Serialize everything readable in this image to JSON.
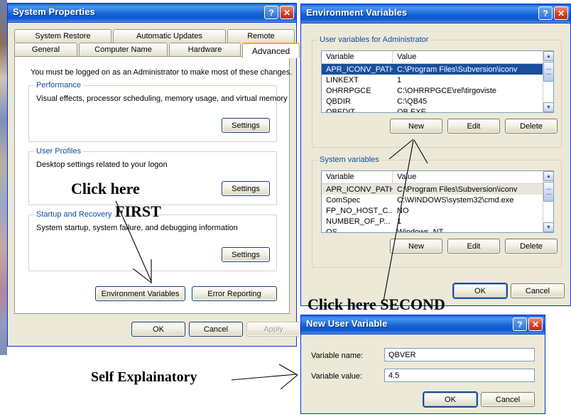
{
  "system_properties": {
    "title": "System Properties",
    "titlebar_buttons": [
      {
        "name": "help-button",
        "glyph": "?"
      },
      {
        "name": "close-button",
        "glyph": "✕"
      }
    ],
    "tabs_row1": [
      {
        "label": "System Restore",
        "active": false
      },
      {
        "label": "Automatic Updates",
        "active": false
      },
      {
        "label": "Remote",
        "active": false
      }
    ],
    "tabs_row2": [
      {
        "label": "General",
        "active": false
      },
      {
        "label": "Computer Name",
        "active": false
      },
      {
        "label": "Hardware",
        "active": false
      },
      {
        "label": "Advanced",
        "active": true
      }
    ],
    "intro_text": "You must be logged on as an Administrator to make most of these changes.",
    "groups": [
      {
        "legend": "Performance",
        "description": "Visual effects, processor scheduling, memory usage, and virtual memory",
        "button": "Settings"
      },
      {
        "legend": "User Profiles",
        "description": "Desktop settings related to your logon",
        "button": "Settings"
      },
      {
        "legend": "Startup and Recovery",
        "description": "System startup, system failure, and debugging information",
        "button": "Settings"
      }
    ],
    "env_button": "Environment Variables",
    "error_button": "Error Reporting",
    "footer_buttons": [
      {
        "label": "OK",
        "disabled": false
      },
      {
        "label": "Cancel",
        "disabled": false
      },
      {
        "label": "Apply",
        "disabled": true
      }
    ]
  },
  "environment_variables": {
    "title": "Environment Variables",
    "titlebar_buttons": [
      {
        "name": "help-button",
        "glyph": "?"
      },
      {
        "name": "close-button",
        "glyph": "✕"
      }
    ],
    "user_group_legend": "User variables for Administrator",
    "system_group_legend": "System variables",
    "columns": [
      "Variable",
      "Value"
    ],
    "user_variables": [
      {
        "variable": "APR_ICONV_PATH",
        "value": "C:\\Program Files\\Subversion\\iconv",
        "selected": true
      },
      {
        "variable": "LINKEXT",
        "value": "1",
        "selected": false
      },
      {
        "variable": "OHRRPGCE",
        "value": "C:\\OHRRPGCE\\rel\\tirgoviste",
        "selected": false
      },
      {
        "variable": "QBDIR",
        "value": "C:\\QB45",
        "selected": false
      },
      {
        "variable": "QBEDIT",
        "value": "QB.EXE",
        "selected": false
      }
    ],
    "system_variables": [
      {
        "variable": "APR_ICONV_PATH",
        "value": "C:\\Program Files\\Subversion\\iconv",
        "selected": true
      },
      {
        "variable": "ComSpec",
        "value": "C:\\WINDOWS\\system32\\cmd.exe",
        "selected": false
      },
      {
        "variable": "FP_NO_HOST_C...",
        "value": "NO",
        "selected": false
      },
      {
        "variable": "NUMBER_OF_P...",
        "value": "1",
        "selected": false
      },
      {
        "variable": "OS",
        "value": "Windows_NT",
        "selected": false
      }
    ],
    "user_action_buttons": [
      "New",
      "Edit",
      "Delete"
    ],
    "system_action_buttons": [
      "New",
      "Edit",
      "Delete"
    ],
    "footer_buttons": [
      {
        "label": "OK",
        "default": true
      },
      {
        "label": "Cancel",
        "default": false
      }
    ]
  },
  "new_user_variable": {
    "title": "New User Variable",
    "titlebar_buttons": [
      {
        "name": "help-button",
        "glyph": "?"
      },
      {
        "name": "close-button",
        "glyph": "✕"
      }
    ],
    "fields": [
      {
        "label": "Variable name:",
        "value": "QBVER"
      },
      {
        "label": "Variable value:",
        "value": "4.5"
      }
    ],
    "footer_buttons": [
      {
        "label": "OK",
        "default": true
      },
      {
        "label": "Cancel",
        "default": false
      }
    ]
  },
  "annotations": [
    {
      "text": "Click here",
      "name": "annotation-click-here-first-line1"
    },
    {
      "text": "FIRST",
      "name": "annotation-click-here-first-line2"
    },
    {
      "text": "Click here SECOND",
      "name": "annotation-click-here-second"
    },
    {
      "text": "Self Explainatory",
      "name": "annotation-self-explanatory"
    }
  ],
  "colors": {
    "titlebar_blue": "#0a5fd4",
    "dialog_face": "#ece9d8",
    "group_legend": "#0b4fa0",
    "selection_blue": "#1a4f9c",
    "active_tab_accent": "#f2a93b",
    "window_border": "#0831d9"
  }
}
